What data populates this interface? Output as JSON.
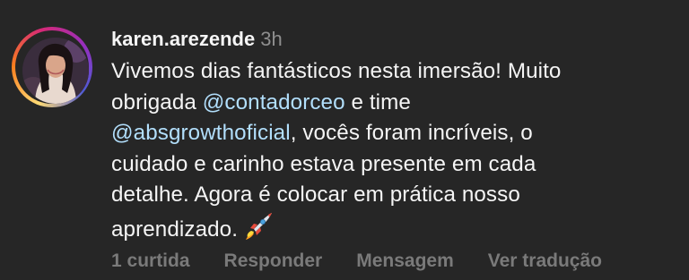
{
  "comment": {
    "username": "karen.arezende",
    "time": "3h",
    "text_parts": {
      "line1": "Vivemos dias fantásticos nesta imersão! Muito",
      "line2_pre": "obrigada ",
      "mention1": "@contadorceo",
      "line2_post": " e time",
      "mention2": "@absgrowthoficial",
      "line3_post": ", vocês foram incríveis, o",
      "line4": "cuidado e carinho estava presente em cada",
      "line5": "detalhe. Agora é colocar em prática nosso",
      "line6": "aprendizado."
    },
    "emoji": "rocket-icon",
    "actions": {
      "likes": "1 curtida",
      "reply": "Responder",
      "message": "Mensagem",
      "translate": "Ver tradução"
    }
  },
  "colors": {
    "background": "#262626",
    "text": "#f5f5f5",
    "muted": "#8e8e8e",
    "mention": "#b2dffc",
    "action": "#7a7a7a"
  }
}
